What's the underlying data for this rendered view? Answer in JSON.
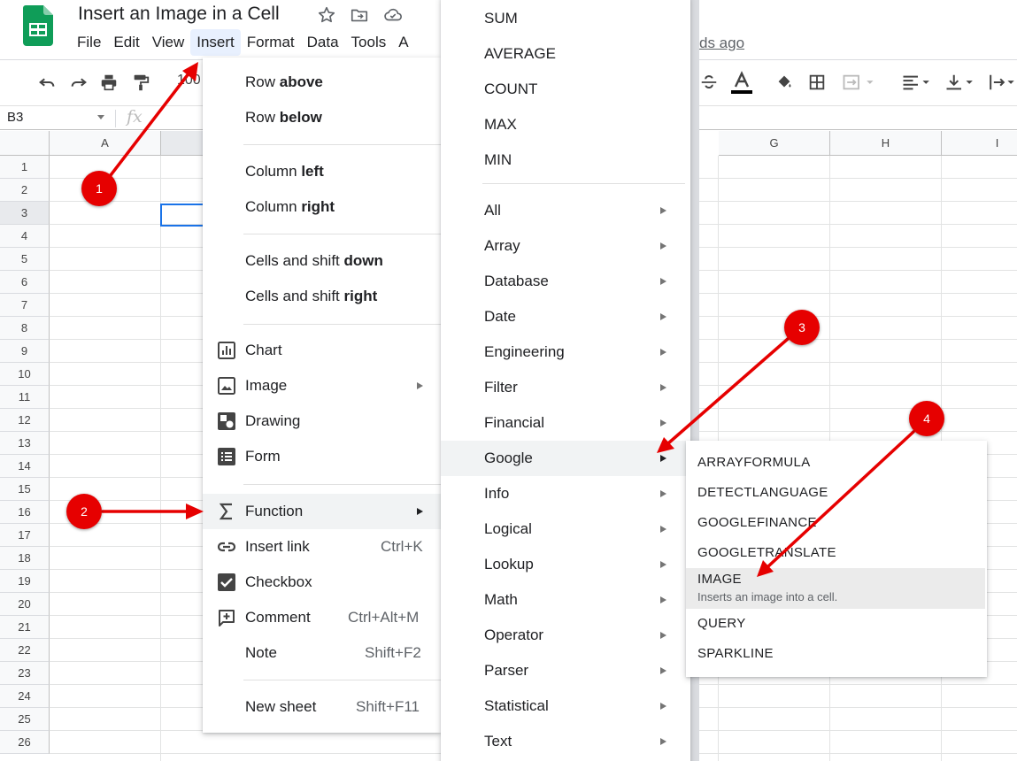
{
  "app": {
    "doc_title": "Insert an Image in a Cell",
    "menubar": [
      "File",
      "Edit",
      "View",
      "Insert",
      "Format",
      "Data",
      "Tools",
      "A"
    ],
    "last_edit": "ds ago",
    "zoom_partial": "100"
  },
  "formula_bar": {
    "name_box": "B3",
    "fx": "fx"
  },
  "grid": {
    "columns": [
      "A",
      "",
      "",
      "",
      "",
      "",
      "G",
      "H",
      "I"
    ],
    "rows": [
      "1",
      "2",
      "3",
      "4",
      "5",
      "6",
      "7",
      "8",
      "9",
      "10",
      "11",
      "12",
      "13",
      "14",
      "15",
      "16",
      "17",
      "18",
      "19",
      "20",
      "21",
      "22",
      "23",
      "24",
      "25",
      "26"
    ],
    "selected_row": "3"
  },
  "insert_menu": {
    "items": [
      {
        "pre": "Row ",
        "bold": "above"
      },
      {
        "pre": "Row ",
        "bold": "below"
      },
      {
        "pre": "Column ",
        "bold": "left"
      },
      {
        "pre": "Column ",
        "bold": "right"
      },
      {
        "pre": "Cells and shift ",
        "bold": "down"
      },
      {
        "pre": "Cells and shift ",
        "bold": "right"
      },
      {
        "label": "Chart",
        "icon": "chart-icon"
      },
      {
        "label": "Image",
        "icon": "image-icon"
      },
      {
        "label": "Drawing",
        "icon": "drawing-icon"
      },
      {
        "label": "Form",
        "icon": "form-icon"
      },
      {
        "label": "Function",
        "icon": "sigma-icon"
      },
      {
        "label": "Insert link",
        "icon": "link-icon",
        "shortcut": "Ctrl+K"
      },
      {
        "label": "Checkbox",
        "icon": "checkbox-icon"
      },
      {
        "label": "Comment",
        "icon": "comment-icon",
        "shortcut": "Ctrl+Alt+M"
      },
      {
        "label": "Note",
        "shortcut": "Shift+F2"
      },
      {
        "label": "New sheet",
        "shortcut": "Shift+F11"
      }
    ]
  },
  "function_menu": {
    "quick": [
      "SUM",
      "AVERAGE",
      "COUNT",
      "MAX",
      "MIN"
    ],
    "categories": [
      "All",
      "Array",
      "Database",
      "Date",
      "Engineering",
      "Filter",
      "Financial",
      "Google",
      "Info",
      "Logical",
      "Lookup",
      "Math",
      "Operator",
      "Parser",
      "Statistical",
      "Text"
    ]
  },
  "google_menu": {
    "items": [
      "ARRAYFORMULA",
      "DETECTLANGUAGE",
      "GOOGLEFINANCE",
      "GOOGLETRANSLATE",
      "IMAGE",
      "QUERY",
      "SPARKLINE"
    ],
    "image_desc": "Inserts an image into a cell."
  },
  "annotations": {
    "badges": [
      "1",
      "2",
      "3",
      "4"
    ],
    "color": "#e60000"
  },
  "colors": {
    "accent": "#1a73e8",
    "sheets_green": "#0f9d58",
    "badge_red": "#e60000"
  }
}
